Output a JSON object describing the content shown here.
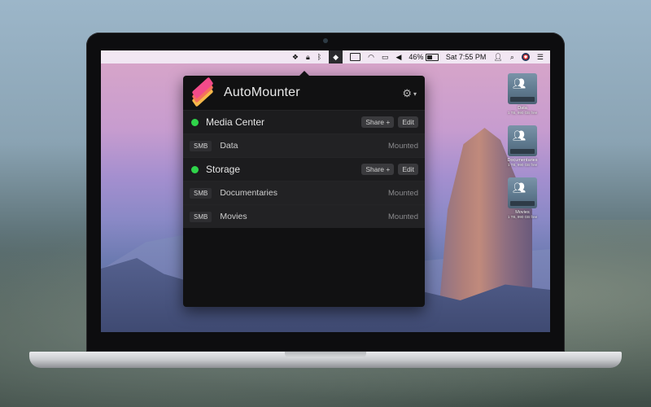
{
  "menubar": {
    "battery": "46%",
    "clock": "Sat 7:55 PM"
  },
  "popup": {
    "title": "AutoMounter",
    "groups": [
      {
        "name": "Media Center",
        "share_button": "Share +",
        "edit_button": "Edit",
        "shares": [
          {
            "protocol": "SMB",
            "name": "Data",
            "status": "Mounted"
          }
        ]
      },
      {
        "name": "Storage",
        "share_button": "Share +",
        "edit_button": "Edit",
        "shares": [
          {
            "protocol": "SMB",
            "name": "Documentaries",
            "status": "Mounted"
          },
          {
            "protocol": "SMB",
            "name": "Movies",
            "status": "Mounted"
          }
        ]
      }
    ]
  },
  "desktop": {
    "drives": [
      {
        "label": "Data",
        "sub": "1 TB, 990 GB free"
      },
      {
        "label": "Documentaries",
        "sub": "1 TB, 990 GB free"
      },
      {
        "label": "Movies",
        "sub": "1 TB, 990 GB free"
      }
    ]
  },
  "colors": {
    "status_online": "#2fd44a",
    "popup_bg": "#111112"
  }
}
